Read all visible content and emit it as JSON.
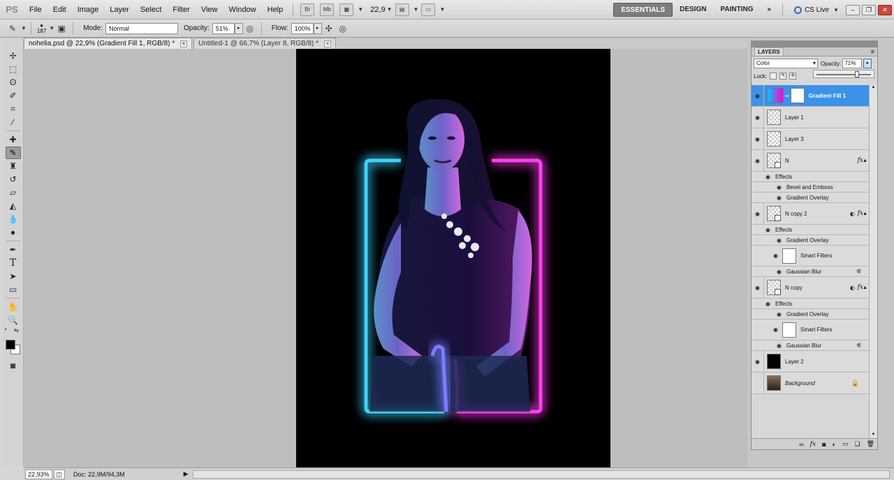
{
  "app": {
    "logo": "PS",
    "menu": [
      "File",
      "Edit",
      "Image",
      "Layer",
      "Select",
      "Filter",
      "View",
      "Window",
      "Help"
    ],
    "bridge_label": "Br",
    "minibridge_label": "Mb",
    "zoom": "22,9",
    "workspaces": [
      "ESSENTIALS",
      "DESIGN",
      "PAINTING"
    ],
    "more_label": "»",
    "cs_live": "CS Live"
  },
  "options": {
    "brush_size": "187",
    "mode_label": "Mode:",
    "mode_value": "Normal",
    "opacity_label": "Opacity:",
    "opacity_value": "51%",
    "flow_label": "Flow:",
    "flow_value": "100%"
  },
  "tabs": [
    {
      "label": "nohelia.psd @ 22,9% (Gradient Fill 1, RGB/8) *",
      "close": "×"
    },
    {
      "label": "Untitled-1 @ 66,7% (Layer 8, RGB/8) *",
      "close": "×"
    }
  ],
  "status": {
    "zoom": "22,93%",
    "doc": "Doc: 22,9M/94,3M",
    "arrow": "▶"
  },
  "layers_panel": {
    "title": "LAYERS",
    "blend_mode": "Color",
    "opacity_label": "Opacity:",
    "opacity_value": "71%",
    "opacity_level": 0.71,
    "lock_label": "Lock:",
    "layers": {
      "gradient_fill": "Gradient Fill 1",
      "layer1": "Layer 1",
      "layer3": "Layer 3",
      "n": "N",
      "effects1": "Effects",
      "bevel": "Bevel and Emboss",
      "grad_overlay1": "Gradient Overlay",
      "n_copy2": "N copy 2",
      "effects2": "Effects",
      "grad_overlay2": "Gradient Overlay",
      "smart_filters1": "Smart Filters",
      "gaussian1": "Gaussian Blur",
      "n_copy": "N copy",
      "effects3": "Effects",
      "grad_overlay3": "Gradient Overlay",
      "smart_filters2": "Smart Filters",
      "gaussian2": "Gaussian Blur",
      "layer2": "Layer 2",
      "background": "Background"
    },
    "fx_label": "fx"
  },
  "colors": {
    "accent": "#3b92e8",
    "neon_cyan": "#3fd2ff",
    "neon_magenta": "#ff3df0"
  }
}
